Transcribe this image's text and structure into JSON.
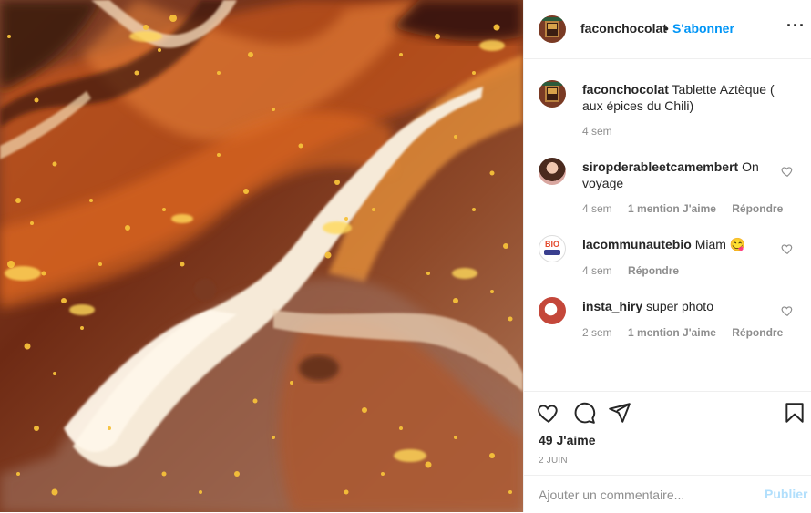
{
  "post": {
    "photo_alt_icon": "chocolate-marble-photo",
    "author": "faconchocolat",
    "follow_label": "S'abonner",
    "dot": "•",
    "more_label": "···"
  },
  "comments": [
    {
      "user": "faconchocolat",
      "text": "Tablette Aztèque ( aux épices du Chili)",
      "time": "4 sem",
      "likes": "",
      "reply": ""
    },
    {
      "user": "siropderableetcamembert",
      "text": "On voyage",
      "time": "4 sem",
      "likes": "1 mention J'aime",
      "reply": "Répondre"
    },
    {
      "user": "lacommunautebio",
      "text": "Miam 😋",
      "time": "4 sem",
      "likes": "",
      "reply": "Répondre",
      "avatar_text": "BIO"
    },
    {
      "user": "insta_hiry",
      "text": "super photo",
      "time": "2 sem",
      "likes": "1 mention J'aime",
      "reply": "Répondre"
    }
  ],
  "actions": {
    "like_icon": "heart-icon",
    "comment_icon": "comment-icon",
    "share_icon": "paper-plane-icon",
    "save_icon": "bookmark-icon",
    "likes_label": "49 J'aime",
    "date_label": "2 JUIN"
  },
  "add_comment": {
    "placeholder": "Ajouter un commentaire...",
    "publish_label": "Publier"
  },
  "colors": {
    "link_blue": "#0095f6",
    "publish_disabled": "#b2dffc",
    "muted": "#8e8e8e"
  }
}
